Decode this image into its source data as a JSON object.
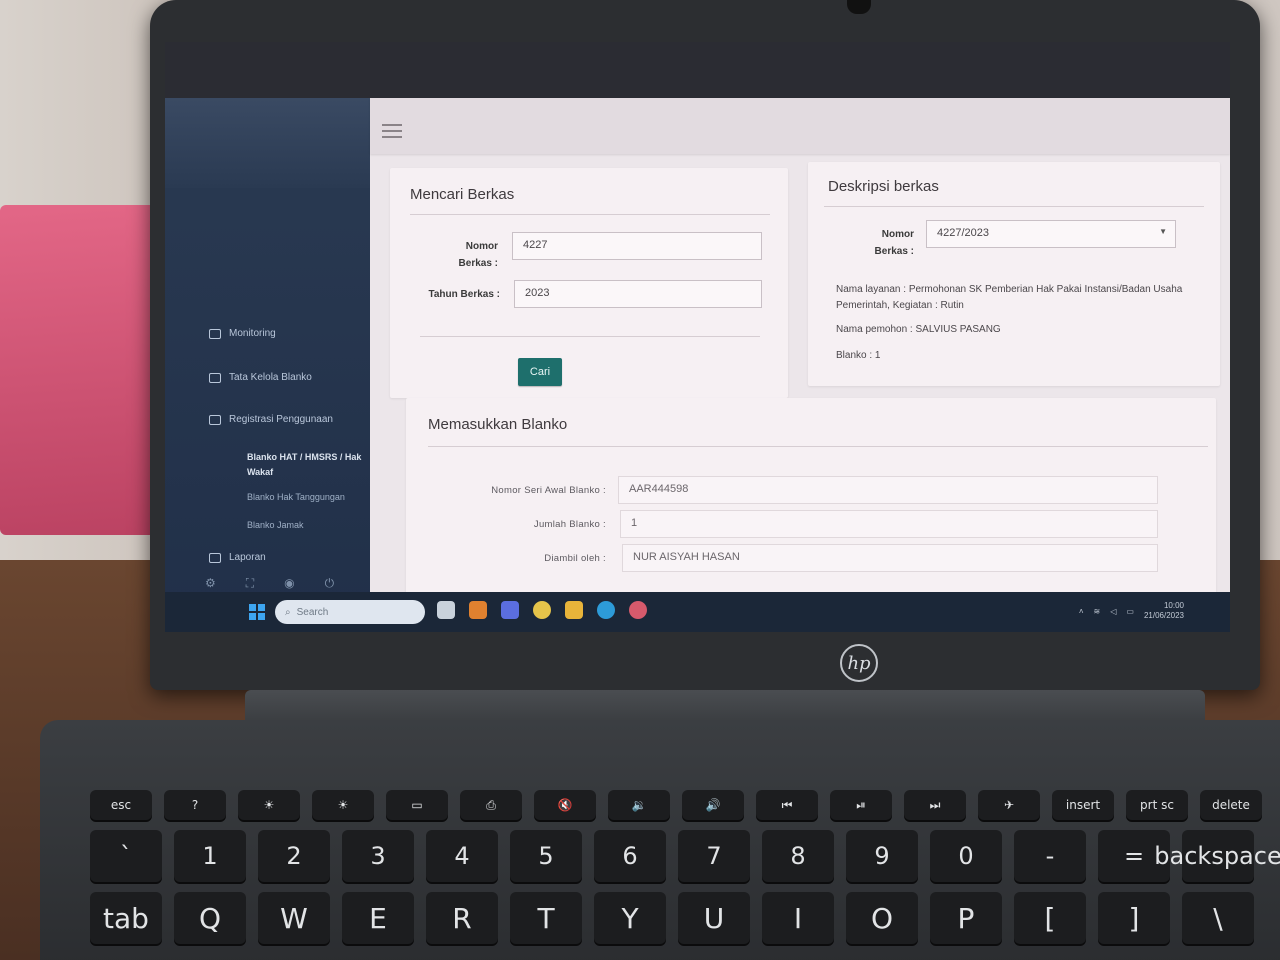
{
  "app": {
    "sidebar": {
      "items": [
        {
          "label": "Monitoring",
          "icon": "monitor-icon"
        },
        {
          "label": "Tata Kelola Blanko",
          "icon": "table-icon",
          "expandable": true
        },
        {
          "label": "Registrasi Penggunaan",
          "icon": "edit-icon",
          "expandable": true
        },
        {
          "label": "Laporan",
          "icon": "document-icon",
          "expandable": true
        }
      ],
      "subitems": [
        {
          "label": "Blanko HAT / HMSRS / Hak Wakaf",
          "active": true
        },
        {
          "label": "Blanko Hak Tanggungan",
          "active": false
        },
        {
          "label": "Blanko Jamak",
          "active": false
        }
      ]
    },
    "search_card": {
      "title": "Mencari Berkas",
      "nomor_label": "Nomor Berkas :",
      "nomor_value": "4227",
      "tahun_label": "Tahun Berkas :",
      "tahun_value": "2023",
      "button_label": "Cari"
    },
    "desc_card": {
      "title": "Deskripsi berkas",
      "nomor_label": "Nomor Berkas :",
      "nomor_selected": "4227/2023",
      "nama_layanan_label": "Nama layanan :",
      "nama_layanan_value": "Permohonan SK Pemberian Hak Pakai Instansi/Badan Usaha Pemerintah, Kegiatan : Rutin",
      "nama_pemohon_label": "Nama pemohon :",
      "nama_pemohon_value": "SALVIUS PASANG",
      "blanko_label": "Blanko :",
      "blanko_value": "1"
    },
    "input_card": {
      "title": "Memasukkan Blanko",
      "seri_label": "Nomor Seri Awal Blanko :",
      "seri_value": "AAR444598",
      "jumlah_label": "Jumlah Blanko :",
      "jumlah_value": "1",
      "diambil_label": "Diambil oleh :",
      "diambil_value": "NUR AISYAH HASAN"
    },
    "taskbar": {
      "search_placeholder": "Search",
      "time": "10:00",
      "date": "21/06/2023"
    }
  },
  "device": {
    "brand": "hp",
    "keys_f": [
      "esc",
      "?",
      "☀",
      "☀",
      "▭",
      "⎙",
      "🔇",
      "🔉",
      "🔊",
      "⏮",
      "⏯",
      "⏭",
      "✈",
      "insert",
      "prt sc",
      "delete"
    ],
    "keys_n": [
      "`",
      "1",
      "2",
      "3",
      "4",
      "5",
      "6",
      "7",
      "8",
      "9",
      "0",
      "-",
      "=",
      "backspace"
    ],
    "keys_q": [
      "tab",
      "Q",
      "W",
      "E",
      "R",
      "T",
      "Y",
      "U",
      "I",
      "O",
      "P",
      "[",
      "]",
      "\\"
    ]
  },
  "colors": {
    "sidebar_bg": "#2a3a52",
    "button_bg": "#1e6f6c",
    "page_bg": "#ece6ea",
    "taskbar_bg": "#1b2738"
  }
}
